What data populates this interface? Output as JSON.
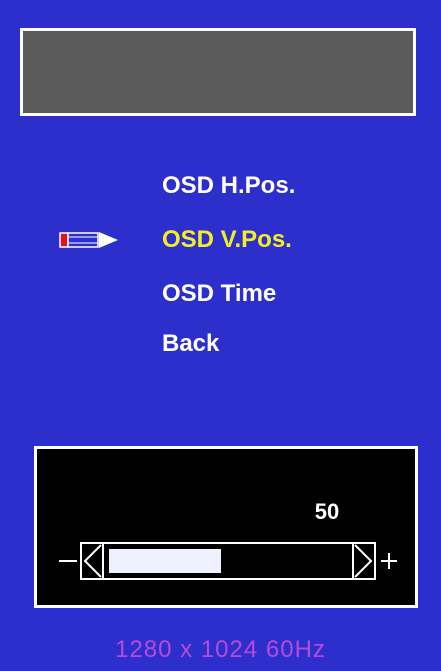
{
  "title": "",
  "menu": {
    "items": [
      {
        "label": "OSD H.Pos.",
        "selected": false
      },
      {
        "label": "OSD V.Pos.",
        "selected": true
      },
      {
        "label": "OSD Time",
        "selected": false
      },
      {
        "label": "Back",
        "selected": false
      }
    ],
    "pointer_icon": "pencil-pointer-icon"
  },
  "slider": {
    "value": "50",
    "level": 0.5,
    "minus_symbol": "−",
    "plus_symbol": "+"
  },
  "status": {
    "resolution": "1280 x 1024  60Hz"
  },
  "colors": {
    "background": "#2c2fcc",
    "selected_text": "#f5ee22",
    "resolution_text": "#b94ad8",
    "title_box": "#5a5a5a"
  }
}
